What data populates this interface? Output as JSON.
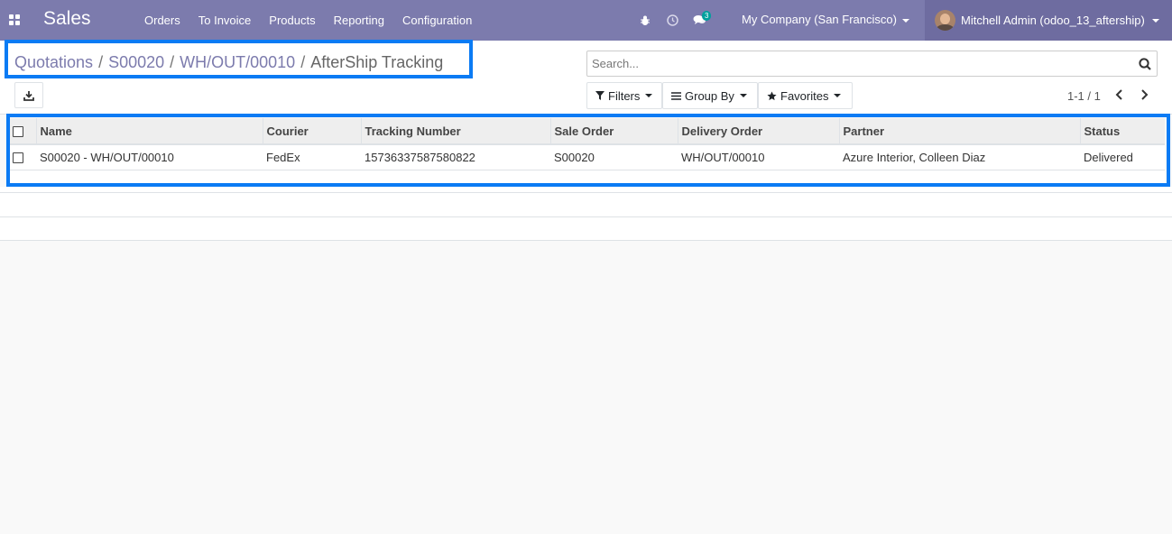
{
  "navbar": {
    "brand": "Sales",
    "menu": [
      "Orders",
      "To Invoice",
      "Products",
      "Reporting",
      "Configuration"
    ],
    "messages_badge": "3",
    "company": "My Company (San Francisco)",
    "user": "Mitchell Admin (odoo_13_aftership)",
    "bg_color": "#7c7bad"
  },
  "breadcrumb": {
    "items": [
      "Quotations",
      "S00020",
      "WH/OUT/00010"
    ],
    "current": "AfterShip Tracking"
  },
  "search": {
    "placeholder": "Search...",
    "value": ""
  },
  "filters": {
    "filters_label": "Filters",
    "group_by_label": "Group By",
    "favorites_label": "Favorites"
  },
  "pager": {
    "text": "1-1 / 1"
  },
  "table": {
    "columns": [
      "Name",
      "Courier",
      "Tracking Number",
      "Sale Order",
      "Delivery Order",
      "Partner",
      "Status"
    ],
    "rows": [
      {
        "name": "S00020 - WH/OUT/00010",
        "courier": "FedEx",
        "tracking_number": "15736337587580822",
        "sale_order": "S00020",
        "delivery_order": "WH/OUT/00010",
        "partner": "Azure Interior, Colleen Diaz",
        "status": "Delivered"
      }
    ]
  },
  "highlight_color": "#0b7bf4"
}
